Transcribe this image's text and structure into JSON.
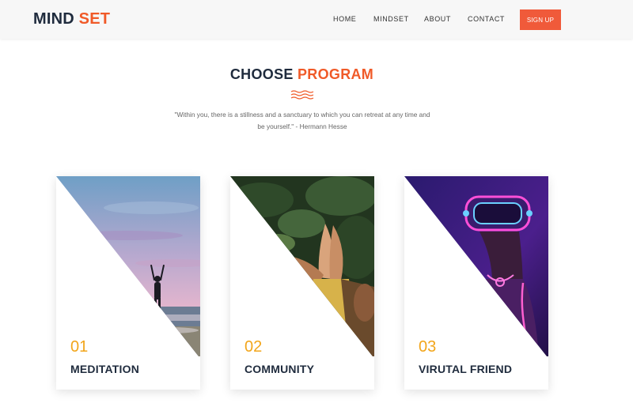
{
  "brand": {
    "name_primary": "MIND",
    "name_accent": "SET"
  },
  "nav": {
    "links": [
      "HOME",
      "MINDSET",
      "ABOUT",
      "CONTACT"
    ],
    "signup_label": "SIGN UP"
  },
  "section": {
    "title_primary": "CHOOSE",
    "title_accent": "PROGRAM",
    "quote_line1": "\"Within you, there is a stillness and a sanctuary to which you can retreat at any time and",
    "quote_line2": "be yourself.\" - Hermann Hesse"
  },
  "programs": [
    {
      "number": "01",
      "title": "MEDITATION",
      "image": "meditation-beach-photo"
    },
    {
      "number": "02",
      "title": "COMMUNITY",
      "image": "hands-high-five-photo"
    },
    {
      "number": "03",
      "title": "VIRUTAL FRIEND",
      "image": "vr-headset-neon-photo"
    }
  ],
  "colors": {
    "accent": "#f05a28",
    "dark": "#1f2b3d",
    "number": "#f2a51a"
  }
}
